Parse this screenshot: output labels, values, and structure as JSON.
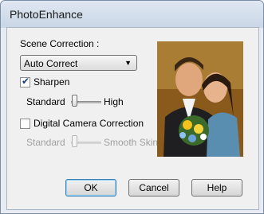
{
  "window": {
    "title": "PhotoEnhance"
  },
  "scene_correction": {
    "label": "Scene Correction :",
    "selected": "Auto Correct"
  },
  "sharpen": {
    "label": "Sharpen",
    "checked": true,
    "slider": {
      "min_label": "Standard",
      "max_label": "High",
      "level": 0
    }
  },
  "digital_camera_correction": {
    "label": "Digital Camera Correction",
    "checked": false,
    "slider": {
      "min_label": "Standard",
      "max_label": "Smooth Skin",
      "level": 0,
      "enabled": false
    }
  },
  "buttons": {
    "ok": "OK",
    "cancel": "Cancel",
    "help": "Help"
  }
}
